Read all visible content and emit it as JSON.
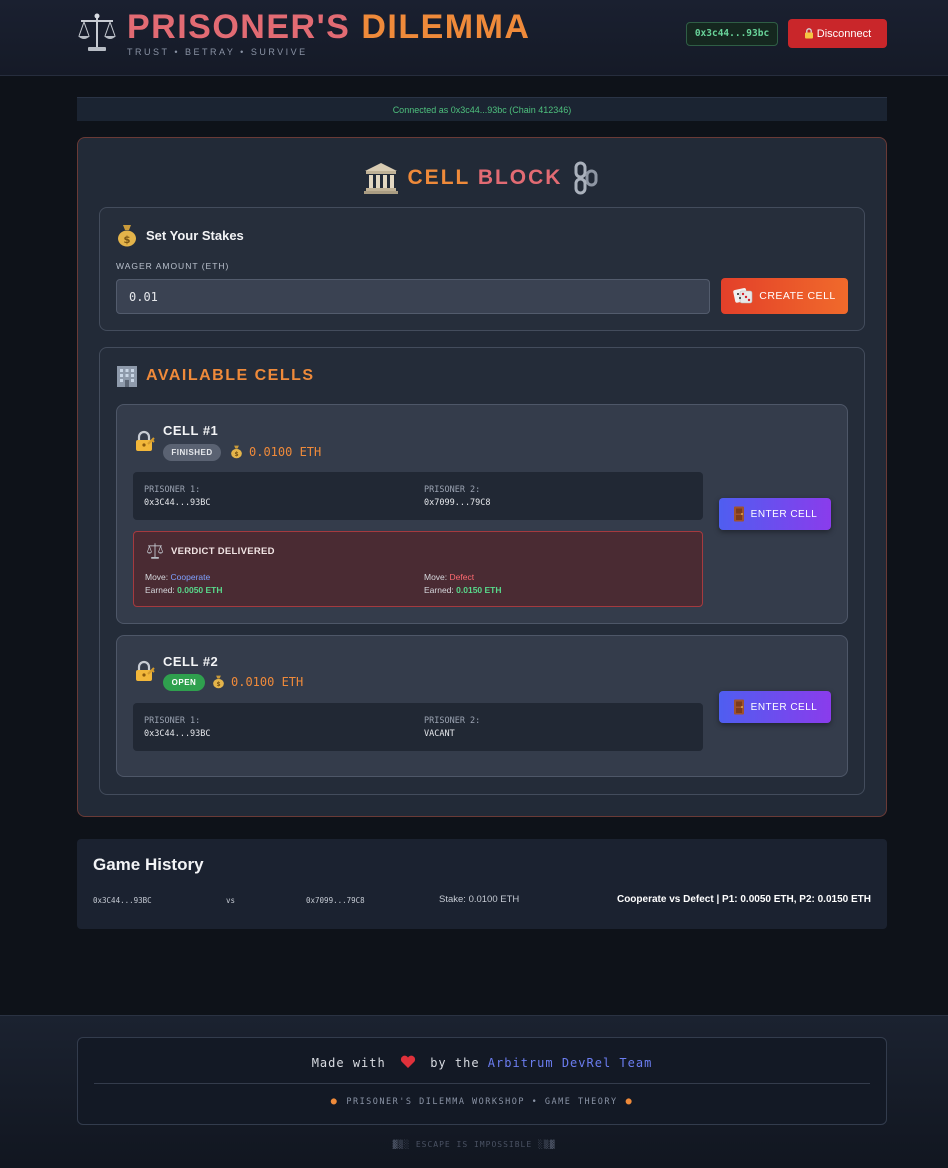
{
  "header": {
    "title_part1": "PRISONER'S",
    "title_part2": "DILEMMA",
    "subtitle": "TRUST • BETRAY • SURVIVE",
    "wallet_address": "0x3c44...93bc",
    "disconnect_label": "Disconnect",
    "icons": [
      "scales-icon",
      "lock-icon"
    ]
  },
  "status": {
    "text": "Connected as 0x3c44...93bc (Chain 412346)"
  },
  "cell_block": {
    "title_part1": "CELL",
    "title_part2": "BLOCK",
    "stakes": {
      "heading": "Set Your Stakes",
      "wager_label": "WAGER AMOUNT (ETH)",
      "wager_value": "0.01",
      "create_label": "CREATE CELL"
    },
    "available": {
      "heading": "AVAILABLE CELLS",
      "cells": [
        {
          "name": "CELL #1",
          "status": "FINISHED",
          "stake": "0.0100 ETH",
          "p1_label": "PRISONER 1:",
          "p1_value": "0x3C44...93BC",
          "p2_label": "PRISONER 2:",
          "p2_value": "0x7099...79C8",
          "enter_label": "ENTER CELL",
          "verdict": {
            "heading": "VERDICT DELIVERED",
            "move_label": "Move:",
            "earned_label": "Earned:",
            "p1_move": "Cooperate",
            "p1_earned": "0.0050 ETH",
            "p2_move": "Defect",
            "p2_earned": "0.0150 ETH"
          }
        },
        {
          "name": "CELL #2",
          "status": "OPEN",
          "stake": "0.0100 ETH",
          "p1_label": "PRISONER 1:",
          "p1_value": "0x3C44...93BC",
          "p2_label": "PRISONER 2:",
          "p2_value": "VACANT",
          "enter_label": "ENTER CELL"
        }
      ]
    }
  },
  "history": {
    "heading": "Game History",
    "rows": [
      {
        "player1": "0x3C44...93BC",
        "vs": "vs",
        "player2": "0x7099...79C8",
        "stake": "Stake: 0.0100 ETH",
        "result": "Cooperate vs Defect | P1: 0.0050 ETH, P2: 0.0150 ETH"
      }
    ]
  },
  "footer": {
    "made_with": "Made with",
    "by_the": "by the",
    "team": "Arbitrum DevRel Team",
    "workshop": "PRISONER'S DILEMMA WORKSHOP • GAME THEORY",
    "escape": "▓▒░ ESCAPE IS IMPOSSIBLE ░▒▓"
  },
  "colors": {
    "accent_orange": "#ef8a3a",
    "accent_red": "#e26b73",
    "success_green": "#58d98b",
    "button_purple": "#8a3cec",
    "danger": "#c9262a"
  }
}
